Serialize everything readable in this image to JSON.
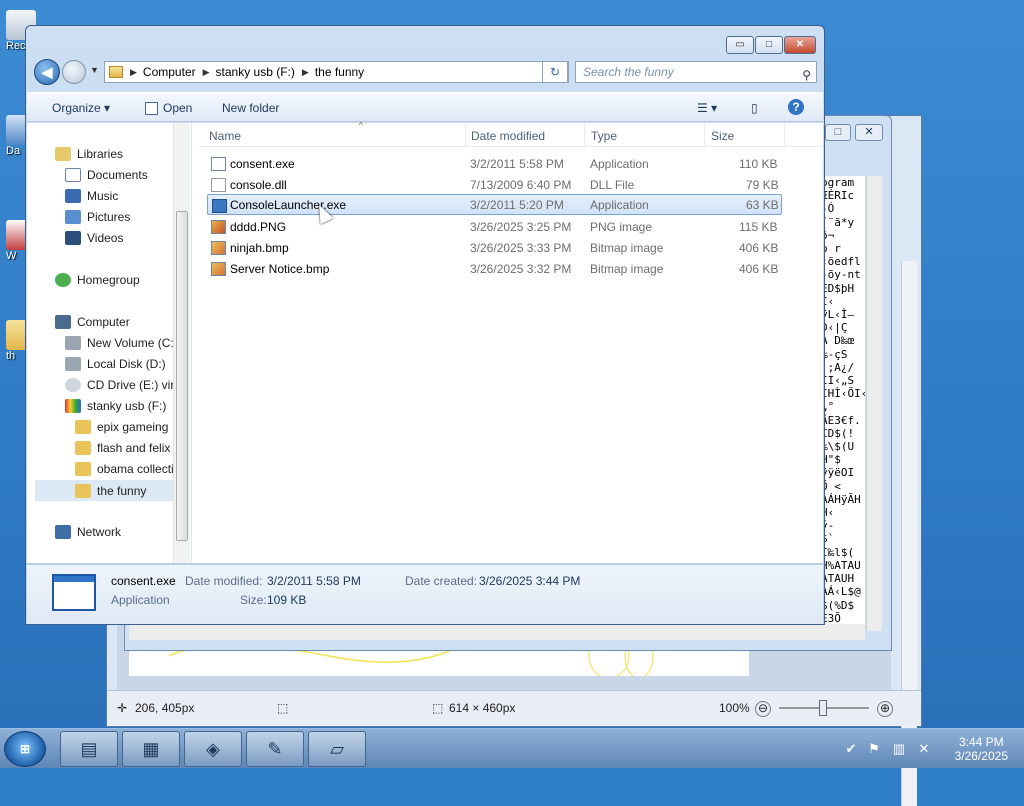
{
  "desktop": {
    "icons": [
      "Rec",
      "Da",
      "W",
      "th"
    ]
  },
  "paint": {
    "status": {
      "cursor_pos": "206, 405px",
      "size": "614 × 460px",
      "zoom": "100%",
      "zoom_out": "⊖",
      "zoom_in": "⊕"
    }
  },
  "notepad": {
    "text_lines": [
      "ogram",
      "ÆÉRIc",
      "-Ó",
      "´¨ã*y",
      "ð¬",
      "o r",
      "‹õedfl",
      "-õy-nt",
      "ED$þH",
      "I‹",
      "ÿL‹Ì—",
      "D‹|Ç",
      "A D‰œ",
      "‰-çS",
      "·;A¿/",
      "ÌI‹„S",
      "ÌHÌ‹ÕI‹",
      "„°",
      "ÄE3€f.",
      "CD$(!",
      "‰\\$(U",
      "H\"$",
      "ÿÿëOI",
      "Ö <",
      "ÀÁHÿÃH",
      "H‹",
      "ý-",
      "$`",
      "Ì‰l$(",
      "H%ATAU",
      "ATAUH",
      "ÀÁ‹L$@",
      "$(%D$",
      "E3Õ"
    ]
  },
  "explorer": {
    "window_buttons": {
      "minimize": "▭",
      "maximize": "□",
      "close": "✕"
    },
    "nav": {
      "back": "◀",
      "history": "▼"
    },
    "address": {
      "segments": [
        "Computer",
        "stanky usb (F:)",
        "the funny"
      ],
      "dropdown": "▾",
      "refresh": "↻"
    },
    "search": {
      "placeholder": "Search the funny",
      "icon": "🔍"
    },
    "commands": {
      "organize": "Organize ▾",
      "open": "Open",
      "new_folder": "New folder",
      "help": "?"
    },
    "navpane": {
      "libraries": "Libraries",
      "documents": "Documents",
      "music": "Music",
      "pictures": "Pictures",
      "videos": "Videos",
      "homegroup": "Homegroup",
      "computer": "Computer",
      "new_volume": "New Volume (C:)",
      "local_disk": "Local Disk (D:)",
      "cd_drive": "CD Drive (E:) virti",
      "stanky": "stanky usb (F:)",
      "epix": "epix gameing",
      "flash": "flash and felix",
      "obama": "obama collecti",
      "funny": "the funny",
      "network": "Network"
    },
    "columns": {
      "name": "Name",
      "date": "Date modified",
      "type": "Type",
      "size": "Size"
    },
    "files": [
      {
        "name": "consent.exe",
        "date": "3/2/2011 5:58 PM",
        "type": "Application",
        "size": "110 KB"
      },
      {
        "name": "console.dll",
        "date": "7/13/2009 6:40 PM",
        "type": "DLL File",
        "size": "79 KB"
      },
      {
        "name": "ConsoleLauncher.exe",
        "date": "3/2/2011 5:20 PM",
        "type": "Application",
        "size": "63 KB"
      },
      {
        "name": "dddd.PNG",
        "date": "3/26/2025 3:25 PM",
        "type": "PNG image",
        "size": "115 KB"
      },
      {
        "name": "ninjah.bmp",
        "date": "3/26/2025 3:33 PM",
        "type": "Bitmap image",
        "size": "406 KB"
      },
      {
        "name": "Server Notice.bmp",
        "date": "3/26/2025 3:32 PM",
        "type": "Bitmap image",
        "size": "406 KB"
      }
    ],
    "details": {
      "filename": "consent.exe",
      "filetype": "Application",
      "date_modified_label": "Date modified:",
      "date_modified": "3/2/2011 5:58 PM",
      "date_created_label": "Date created:",
      "date_created": "3/26/2025 3:44 PM",
      "size_label": "Size:",
      "size": "109 KB"
    }
  },
  "taskbar": {
    "start": "⊞",
    "time": "3:44 PM",
    "date": "3/26/2025"
  },
  "colors": {
    "accent": "#2f74c9",
    "selection": "#d1e2f7",
    "desktop": "#2f7fc8"
  }
}
